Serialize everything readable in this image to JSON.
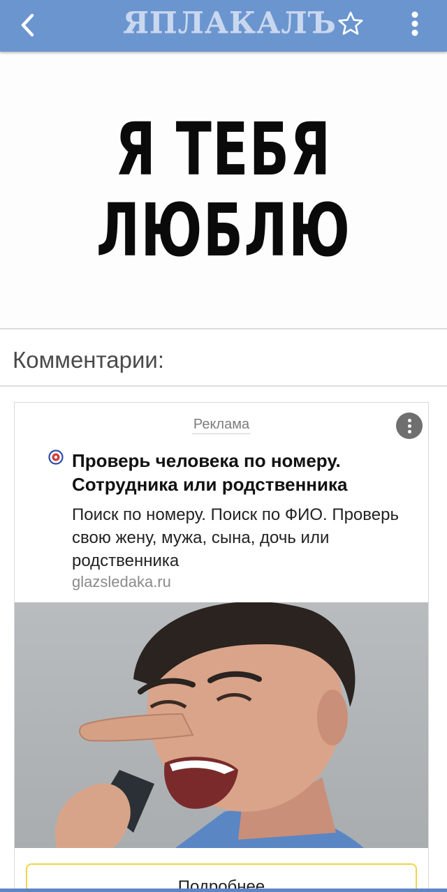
{
  "topbar": {
    "logo_text": "ЯПЛАКАЛЪ",
    "back_icon": "chevron-left-icon",
    "favorite_icon": "star-outline-icon",
    "menu_icon": "more-vertical-icon",
    "background_color": "#6b95cf"
  },
  "post": {
    "image_text_line1": "Я ТЕБЯ",
    "image_text_line2": "ЛЮБЛЮ"
  },
  "comments": {
    "title": "Комментарии:"
  },
  "ad": {
    "label": "Реклама",
    "more_icon": "more-vertical-icon",
    "favicon": "target-icon",
    "title": "Проверь человека по номеру. Сотрудника или родственника",
    "body": "Поиск по номеру. Поиск по ФИО. Проверь свою жену, мужа, сына, дочь или родственника",
    "domain": "glazsledaka.ru",
    "button_label": "Подробнее",
    "button_border_color": "#f1d44a"
  }
}
